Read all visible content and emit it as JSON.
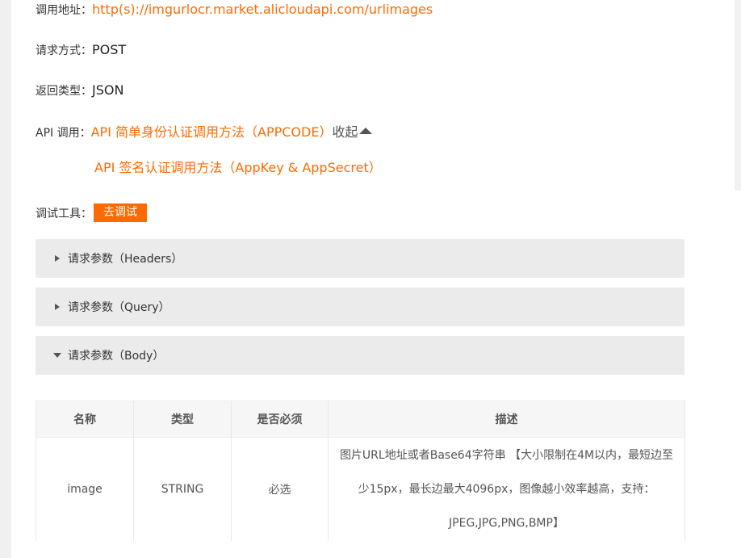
{
  "endpoint": {
    "address_label": "调用地址：",
    "address_url": "http(s)://imgurlocr.market.alicloudapi.com/urlimages",
    "method_label": "请求方式：",
    "method_value": "POST",
    "return_label": "返回类型：",
    "return_value": "JSON"
  },
  "api_call": {
    "label": "API 调用：",
    "simple_auth_link": "API 简单身份认证调用方法（APPCODE）",
    "collapse_label": "收起",
    "sign_auth_link": "API 签名认证调用方法（AppKey & AppSecret）"
  },
  "debug": {
    "label": "调试工具：",
    "button": "去调试"
  },
  "panels": [
    {
      "title": "请求参数（Headers）",
      "expanded": false
    },
    {
      "title": "请求参数（Query）",
      "expanded": false
    },
    {
      "title": "请求参数（Body）",
      "expanded": true
    }
  ],
  "body_table": {
    "headers": [
      "名称",
      "类型",
      "是否必须",
      "描述"
    ],
    "rows": [
      {
        "name": "image",
        "type": "STRING",
        "required": "必选",
        "description_lines": [
          "图片URL地址或者Base64字符串 【大小限制在4M以内，最短边至",
          "少15px，最长边最大4096px，图像越小效率越高，支持：",
          "JPEG,JPG,PNG,BMP】"
        ]
      }
    ]
  },
  "colors": {
    "accent": "#ff6a00",
    "panel_bg": "#ebebeb",
    "table_header_bg": "#f5f6f5"
  }
}
